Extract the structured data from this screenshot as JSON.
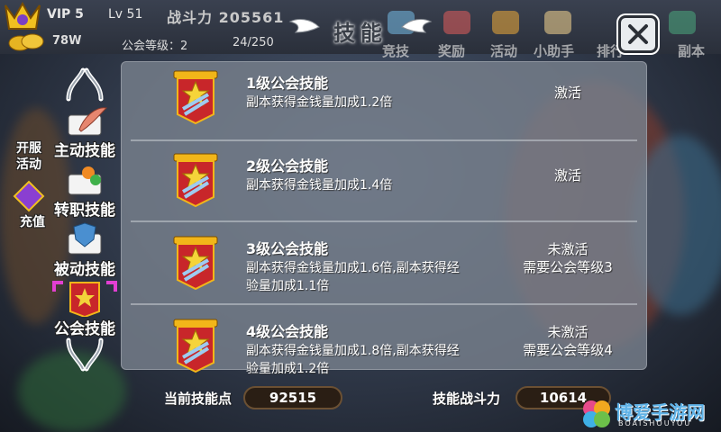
{
  "hud": {
    "vip": "VIP 5",
    "level": "Lv 51",
    "power": "战斗力 205561",
    "gold": "78W",
    "guild_level": "公会等级：2",
    "capacity": "24/250",
    "menu": [
      "竞技",
      "奖励",
      "活动",
      "小助手",
      "排行",
      "副本"
    ]
  },
  "side": {
    "items": [
      "开服活动",
      "充值"
    ]
  },
  "dialog": {
    "title": "技能",
    "close_icon": "close-icon"
  },
  "tabs": [
    {
      "label": "主动技能",
      "icon": "feather-icon",
      "selected": false
    },
    {
      "label": "转职技能",
      "icon": "class-change-icon",
      "selected": false
    },
    {
      "label": "被动技能",
      "icon": "shield-book-icon",
      "selected": false
    },
    {
      "label": "公会技能",
      "icon": "guild-banner-icon",
      "selected": true
    }
  ],
  "skills": [
    {
      "title": "1级公会技能",
      "desc": "副本获得金钱量加成1.2倍",
      "status": [
        "激活"
      ]
    },
    {
      "title": "2级公会技能",
      "desc": "副本获得金钱量加成1.4倍",
      "status": [
        "激活"
      ]
    },
    {
      "title": "3级公会技能",
      "desc": "副本获得金钱量加成1.6倍,副本获得经验量加成1.1倍",
      "status": [
        "未激活",
        "需要公会等级3"
      ]
    },
    {
      "title": "4级公会技能",
      "desc": "副本获得金钱量加成1.8倍,副本获得经验量加成1.2倍",
      "status": [
        "未激活",
        "需要公会等级4"
      ]
    }
  ],
  "footer": {
    "points_label": "当前技能点",
    "points_value": "92515",
    "power_label": "技能战斗力",
    "power_value": "10614"
  },
  "watermark": {
    "text": "博爱手游网",
    "sub": "BOAISHOUYOU"
  },
  "colors": {
    "banner_red": "#c8262a",
    "banner_gold": "#f2b619",
    "panel_bg": "#78808c",
    "value_box": "#2a1e14"
  }
}
